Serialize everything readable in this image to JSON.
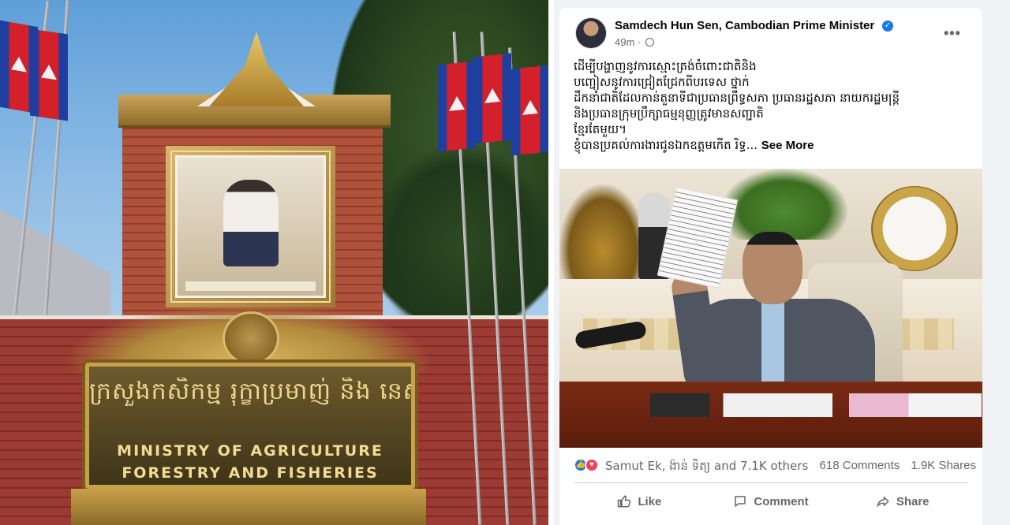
{
  "left_image": {
    "sign_khmer": "ក្រសួងកសិកម្ម រុក្ខាប្រមាញ់ និង នេសាទ",
    "sign_english_line1": "MINISTRY OF AGRICULTURE",
    "sign_english_line2": "FORESTRY AND FISHERIES"
  },
  "post": {
    "author": "Samdech Hun Sen, Cambodian Prime Minister",
    "time": "49m",
    "text_lines": [
      "ដើម្បីបង្ហាញនូវការស្មោះត្រង់ចំពោះជាតិនិង",
      "បញ្ជៀសនូវការជ្រៀតជ្រែកពីបរទេស ថ្នាក់",
      "ដឹកនាំជាតិដែលកាន់តួនាទីជាប្រធានព្រឹទ្ធសភា ប្រធានរដ្ឋសភា នាយករដ្ឋមន្ត្រី",
      "និងប្រធានក្រុមប្រឹក្សាធម្មនុញ្ញត្រូវមានសញ្ជាតិ",
      "ខ្មែរតែមួយ។",
      "ខ្ញុំបានប្រគល់ការងារជូនឯកឧត្តមកើត រិទ្ធ..."
    ],
    "see_more": "See More",
    "reactions": {
      "names": "Samut Ek, ង៉ាន់ ទិត្យ and 7.1K others",
      "comments": "618 Comments",
      "shares": "1.9K Shares"
    },
    "actions": {
      "like": "Like",
      "comment": "Comment",
      "share": "Share"
    },
    "icons": {
      "verified": "verified-badge-icon",
      "privacy": "globe-icon",
      "more": "more-options-icon"
    },
    "colors": {
      "facebook_blue": "#1877f2",
      "love_red": "#f33e58",
      "secondary_text": "#65676b"
    }
  }
}
